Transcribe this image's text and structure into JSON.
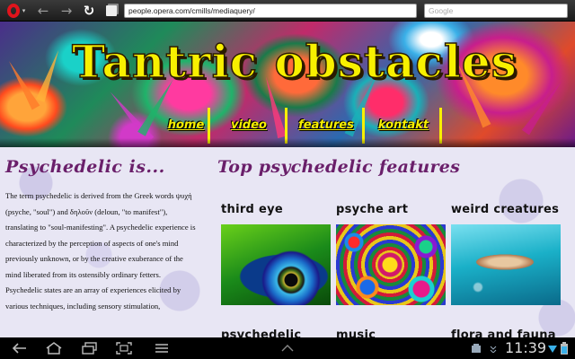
{
  "browser": {
    "url": "people.opera.com/cmills/mediaquery/",
    "search_placeholder": "Google",
    "opera_caret": "▾",
    "back_glyph": "←",
    "forward_glyph": "→",
    "reload_glyph": "↻"
  },
  "site": {
    "title": "Tantric obstacles",
    "nav": [
      "home",
      "video",
      "features",
      "kontakt"
    ]
  },
  "left": {
    "heading": "Psychedelic is...",
    "body": "The term psychedelic is derived from the Greek words ψυχή (psyche, \"soul\") and δηλοῦν (deloun, \"to manifest\"), translating to \"soul-manifesting\". A psychedelic experience is characterized by the perception of aspects of one's mind previously unknown, or by the creative exuberance of the mind liberated from its ostensibly ordinary fetters. Psychedelic states are an array of experiences elicited by various techniques, including sensory stimulation,"
  },
  "features": {
    "heading": "Top psychedelic features",
    "items": [
      {
        "title": "third eye",
        "image": "eye-image"
      },
      {
        "title": "psyche art",
        "image": "swirl-art-image"
      },
      {
        "title": "weird creatures",
        "image": "fish-image"
      },
      {
        "title": "psychedelic",
        "image": ""
      },
      {
        "title": "music",
        "image": ""
      },
      {
        "title": "flora and fauna",
        "image": ""
      }
    ]
  },
  "system_bar": {
    "time": "11:39",
    "icons": [
      "back-icon",
      "home-icon",
      "recent-apps-icon",
      "screenshot-icon",
      "menu-icon",
      "up-icon",
      "notification-icon",
      "wifi-icon",
      "battery-icon"
    ]
  },
  "colors": {
    "title_yellow": "#f8f000",
    "heading_purple": "#6a1f6a",
    "page_bg": "#e8e6f4"
  }
}
